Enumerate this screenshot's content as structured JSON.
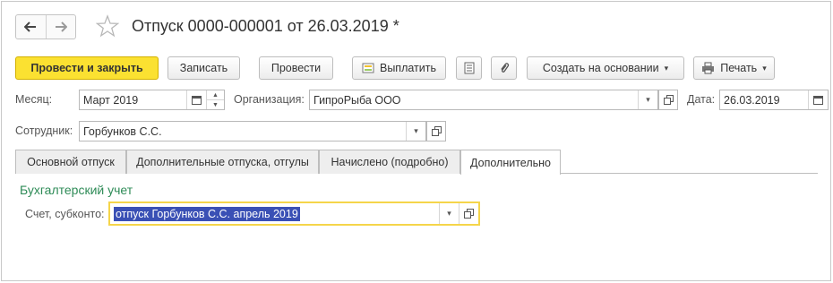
{
  "header": {
    "title": "Отпуск 0000-000001 от 26.03.2019 *"
  },
  "toolbar": {
    "post_close": "Провести и закрыть",
    "save": "Записать",
    "post": "Провести",
    "pay": "Выплатить",
    "create_based": "Создать на основании",
    "print": "Печать"
  },
  "form": {
    "month_label": "Месяц:",
    "month_value": "Март 2019",
    "org_label": "Организация:",
    "org_value": "ГипроРыба ООО",
    "date_label": "Дата:",
    "date_value": "26.03.2019",
    "employee_label": "Сотрудник:",
    "employee_value": "Горбунков С.С."
  },
  "tabs": [
    {
      "label": "Основной отпуск"
    },
    {
      "label": "Дополнительные отпуска, отгулы"
    },
    {
      "label": "Начислено (подробно)"
    },
    {
      "label": "Дополнительно"
    }
  ],
  "additional": {
    "section_title": "Бухгалтерский учет",
    "account_label": "Счет, субконто:",
    "account_value": "отпуск Горбунков С.С. апрель 2019"
  }
}
